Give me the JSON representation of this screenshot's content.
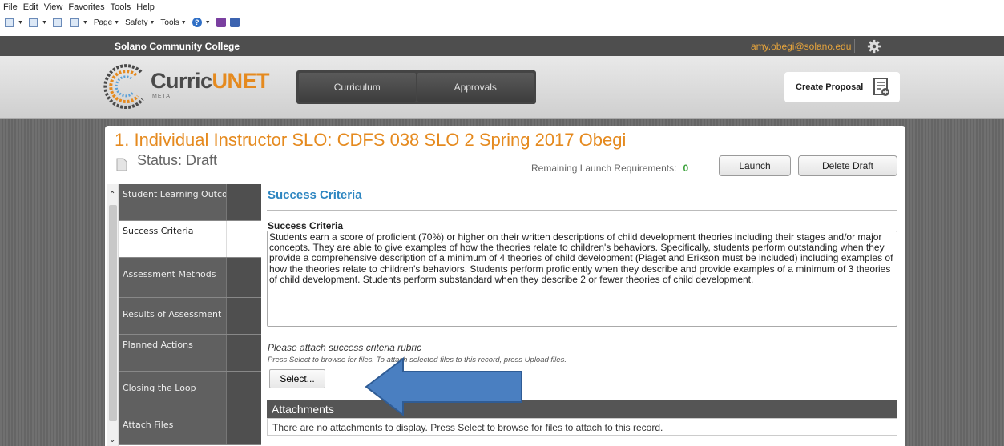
{
  "ie_menu": [
    "File",
    "Edit",
    "View",
    "Favorites",
    "Tools",
    "Help"
  ],
  "ie_cmdbar": {
    "page": "Page",
    "safety": "Safety",
    "tools": "Tools"
  },
  "topbar": {
    "college": "Solano Community College",
    "email": "amy.obegi@solano.edu"
  },
  "header": {
    "logo_main": "Curric",
    "logo_accent": "UNET",
    "logo_sub": "META",
    "nav": [
      "Curriculum",
      "Approvals"
    ],
    "create_proposal": "Create Proposal"
  },
  "record": {
    "title": "1. Individual Instructor SLO: CDFS 038 SLO 2 Spring 2017 Obegi",
    "status": "Status: Draft",
    "remaining_label": "Remaining Launch Requirements:",
    "remaining_count": "0",
    "launch": "Launch",
    "delete_draft": "Delete Draft"
  },
  "sidebar": {
    "items": [
      "Student Learning Outcome",
      "Success Criteria",
      "Assessment Methods",
      "Results of Assessment",
      "Planned Actions",
      "Closing the Loop",
      "Attach Files"
    ]
  },
  "content": {
    "section_title": "Success Criteria",
    "field_label": "Success Criteria",
    "field_value": "Students earn a score of proficient (70%) or higher on their written descriptions of child development theories including their stages and/or major concepts. They are able to give examples of how the theories relate to children's behaviors. Specifically, students perform outstanding when they provide a comprehensive description of a minimum of 4 theories of child development (Piaget and Erikson must be included) including examples of how the theories relate to children's behaviors. Students perform proficiently when they describe and provide examples of a minimum of 3 theories of child development. Students perform substandard when they describe 2 or fewer theories of child development.",
    "attach_label": "Please attach success criteria rubric",
    "attach_hint": "Press Select to browse for files. To attach selected files to this record, press Upload files.",
    "select_button": "Select...",
    "attachments_header": "Attachments",
    "attachments_empty": "There are no attachments to display. Press Select to browse for files to attach to this record."
  },
  "colors": {
    "accent_orange": "#e58a1f",
    "section_blue": "#2e86c1",
    "arrow_blue": "#4a7fc1"
  }
}
